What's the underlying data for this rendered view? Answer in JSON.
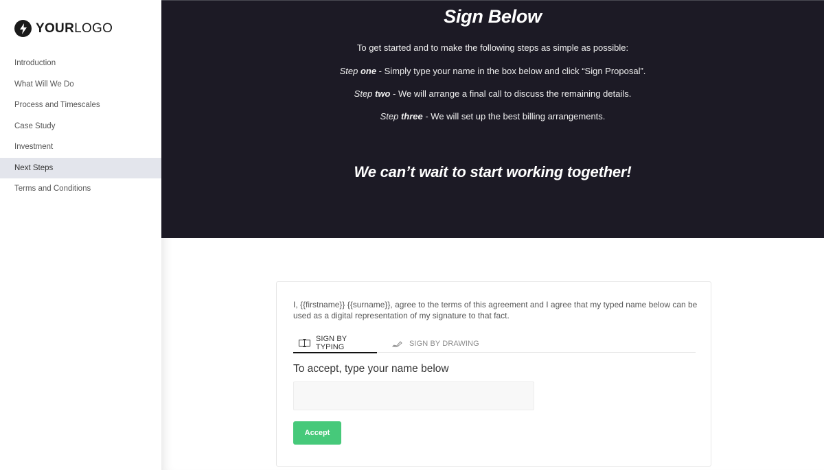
{
  "logo": {
    "bold": "YOUR",
    "light": "LOGO",
    "icon": "lightning-bolt-icon"
  },
  "sidebar": {
    "items": [
      {
        "label": "Introduction",
        "active": false
      },
      {
        "label": "What Will We Do",
        "active": false
      },
      {
        "label": "Process and Timescales",
        "active": false
      },
      {
        "label": "Case Study",
        "active": false
      },
      {
        "label": "Investment",
        "active": false
      },
      {
        "label": "Next Steps",
        "active": true
      },
      {
        "label": "Terms and Conditions",
        "active": false
      }
    ]
  },
  "hero": {
    "title": "Sign Below",
    "intro": "To get started and to make the following steps as simple as possible:",
    "steps": [
      {
        "prefix": "Step ",
        "num": "one",
        "text": " - Simply type your name in the box below and click “Sign Proposal”."
      },
      {
        "prefix": "Step ",
        "num": "two",
        "text": " - We will arrange a final call to discuss the remaining details."
      },
      {
        "prefix": "Step ",
        "num": "three",
        "text": " - We will set up the best billing arrangements."
      }
    ],
    "closing": "We can’t wait to start working together!",
    "background_color": "#1c1a25"
  },
  "signature": {
    "agreement": "I, {{firstname}} {{surname}}, agree to the terms of this agreement and I agree that my typed name below can be used as a digital representation of my signature to that fact.",
    "tabs": [
      {
        "label": "SIGN BY TYPING",
        "icon": "text-cursor-icon",
        "active": true
      },
      {
        "label": "SIGN BY DRAWING",
        "icon": "pen-signature-icon",
        "active": false
      }
    ],
    "input_label": "To accept, type your name below",
    "input_value": "",
    "input_placeholder": "",
    "accept_label": "Accept",
    "accept_color": "#46c97a"
  }
}
